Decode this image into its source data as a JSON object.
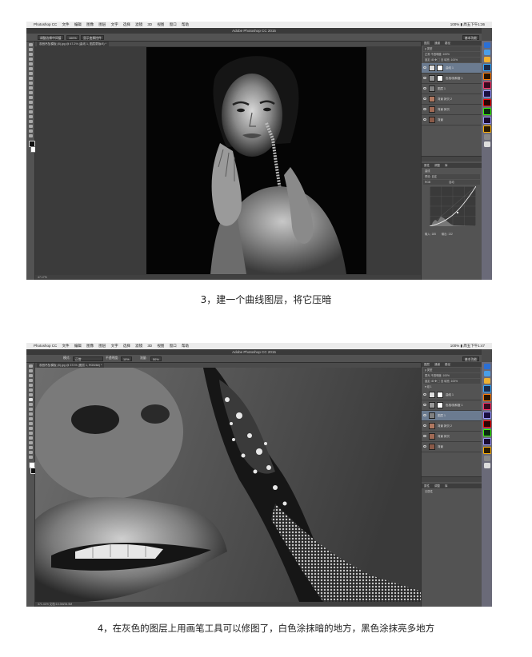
{
  "screenshots": [
    {
      "menubar": {
        "apple": "",
        "items": [
          "Photoshop CC",
          "文件",
          "编辑",
          "图像",
          "图层",
          "文字",
          "选择",
          "滤镜",
          "3D",
          "视图",
          "窗口",
          "帮助"
        ],
        "right": "100% ▮ 周五下午1:36"
      },
      "window_title": "Adobe Photoshop CC 2015",
      "options_bar": {
        "chips": [
          "调整边缘中间值",
          "100%",
          "显示变换控件"
        ],
        "workspace": "基本功能"
      },
      "document_tab": "观音吊坠模板 (8).jpg @ 47.2% (曲线 1, 图层蒙版/8) *",
      "status_text": "47.17%",
      "panel_tabs": [
        "图层",
        "通道",
        "路径"
      ],
      "panel_rows": [
        "ρ 类型",
        "正常    不透明度: 100%",
        "锁定: ⊞ ✥ ▢ ⊠   填充: 100%"
      ],
      "layers": [
        {
          "name": "曲线 1",
          "selected": true,
          "mask": true
        },
        {
          "name": "色相/饱和度 1",
          "selected": false,
          "mask": true
        },
        {
          "name": "图层 1",
          "selected": false,
          "mask": false
        },
        {
          "name": "背景 拷贝 2",
          "selected": false,
          "mask": false
        },
        {
          "name": "背景 拷贝",
          "selected": false,
          "mask": false
        },
        {
          "name": "背景",
          "selected": false,
          "mask": false
        }
      ],
      "properties": {
        "tabs": [
          "属性",
          "调整",
          "库"
        ],
        "title": "曲线",
        "preset_label": "预设:",
        "preset_value": "自定",
        "channel": "RGB",
        "auto_button": "自动",
        "input_label": "输入:",
        "input_value": "185",
        "output_label": "输出:",
        "output_value": "132"
      },
      "caption": "3，建一个曲线图层，将它压暗"
    },
    {
      "menubar": {
        "apple": "",
        "items": [
          "Photoshop CC",
          "文件",
          "编辑",
          "图像",
          "图层",
          "文字",
          "选择",
          "滤镜",
          "3D",
          "视图",
          "窗口",
          "帮助"
        ],
        "right": "100% ▮ 周五下午1:47"
      },
      "window_title": "Adobe Photoshop CC 2015",
      "options_bar": {
        "chips": [
          "模式:",
          "正常",
          "不透明度:",
          "10%",
          "流量:",
          "50%"
        ],
        "workspace": "基本功能"
      },
      "document_tab": "观音吊坠模板 (8).jpg @ 371% (图层 1, RGB/8#) *",
      "status_text": "371.41%   文档:10.3M/34.5M",
      "panel_tabs": [
        "图层",
        "通道",
        "路径"
      ],
      "panel_rows": [
        "ρ 类型",
        "柔光    不透明度: 100%",
        "锁定: ⊞ ✥ ▢ ⊠   填充: 100%",
        "▾ 组 1"
      ],
      "layers": [
        {
          "name": "曲线 1",
          "selected": false,
          "mask": true
        },
        {
          "name": "色相/饱和度 1",
          "selected": false,
          "mask": true
        },
        {
          "name": "图层 1",
          "selected": true,
          "mask": false
        },
        {
          "name": "背景 拷贝 2",
          "selected": false,
          "mask": false
        },
        {
          "name": "背景 拷贝",
          "selected": false,
          "mask": false
        },
        {
          "name": "背景",
          "selected": false,
          "mask": false
        }
      ],
      "properties": {
        "tabs": [
          "属性",
          "调整",
          "库"
        ],
        "title": "无属性"
      },
      "caption": "4，在灰色的图层上用画笔工具可以修图了，白色涂抹暗的地方，黑色涂抹亮多地方"
    }
  ],
  "colors": {
    "ps_dark": "#3b3b3b",
    "ps_panel": "#535353",
    "selection": "#6b7b90",
    "dock": "#6a6a78"
  }
}
